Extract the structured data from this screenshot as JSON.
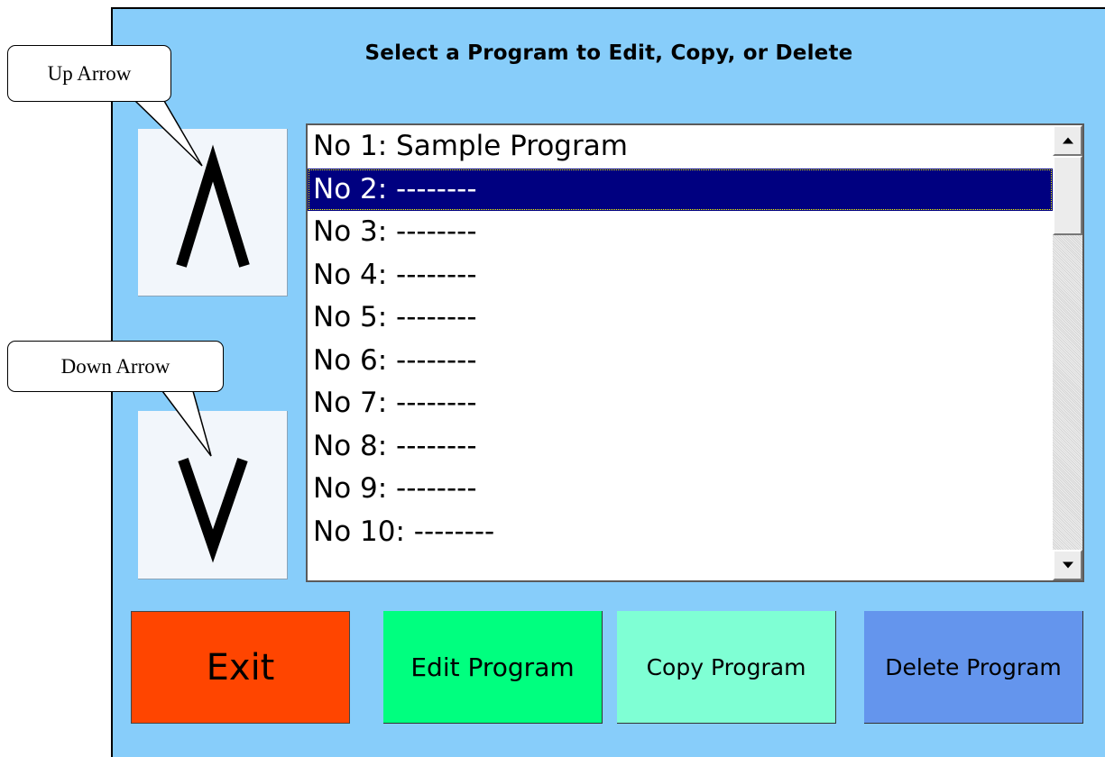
{
  "screen": {
    "title": "Select a Program to Edit, Copy, or Delete"
  },
  "nav": {
    "up_icon": "up-arrow-icon",
    "down_icon": "down-arrow-icon"
  },
  "program_list": {
    "items": [
      "No 1: Sample Program",
      "No 2: --------",
      "No 3: --------",
      "No 4: --------",
      "No 5: --------",
      "No 6: --------",
      "No 7: --------",
      "No 8: --------",
      "No 9: --------",
      "No 10: --------"
    ],
    "selected_index": 1
  },
  "actions": {
    "exit_label": "Exit",
    "edit_label": "Edit Program",
    "copy_label": "Copy Program",
    "delete_label": "Delete Program"
  },
  "callouts": {
    "up_label": "Up Arrow",
    "down_label": "Down Arrow"
  },
  "colors": {
    "background": "#87cdfa",
    "selected_row": "#000080",
    "exit": "#ff4500",
    "edit": "#00ff7f",
    "copy": "#7fffd4",
    "delete": "#6495ed"
  }
}
